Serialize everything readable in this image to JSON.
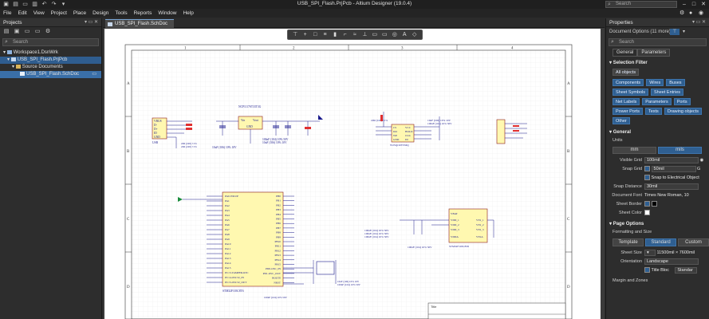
{
  "window": {
    "title": "USB_SPI_Flash.PrjPcb - Altium Designer (19.0.4)",
    "search_placeholder": "Search"
  },
  "menu": [
    "File",
    "Edit",
    "View",
    "Project",
    "Place",
    "Design",
    "Tools",
    "Reports",
    "Window",
    "Help"
  ],
  "projects_panel": {
    "title": "Projects",
    "search_placeholder": "Search",
    "tree": [
      {
        "label": "Workspace1.DsnWrk"
      },
      {
        "label": "USB_SPI_Flash.PrjPcb"
      },
      {
        "label": "Source Documents"
      },
      {
        "label": "USB_SPI_Flash.SchDoc"
      }
    ]
  },
  "document": {
    "tab": "USB_SPI_Flash.SchDoc",
    "col_labels": [
      "1",
      "2",
      "3",
      "4"
    ],
    "row_labels": [
      "A",
      "B",
      "C",
      "D"
    ],
    "title_block": "Title",
    "components": {
      "J1_labels": [
        "VBUS",
        "D-",
        "D+",
        "ID",
        "GND"
      ],
      "J1_name": "USB",
      "u_ldo": "NCP1117ST33T3G",
      "u_ldo_pins": [
        "Vin",
        "Vout",
        "GND"
      ],
      "flash_u": "W25Q16JVSSIQ",
      "flash_pins": [
        "CS",
        "DO",
        "WP",
        "GND",
        "VCC",
        "HOLD",
        "CLK",
        "DI"
      ],
      "mcu": "STM32F103C8T6",
      "mcu_left_pins": [
        "PA0-WKUP",
        "PA1",
        "PA2",
        "PA3",
        "PA4",
        "PA5",
        "PA6",
        "PA7",
        "PA8",
        "PA9",
        "PA10",
        "PA11",
        "PA12",
        "PA13",
        "PA14",
        "PA15",
        "PC13-TAMPER-RTC",
        "PC14-OSC32_IN",
        "PC15-OSC32_OUT"
      ],
      "mcu_right_pins": [
        "PB0",
        "PB1",
        "PB2",
        "PB3",
        "PB4",
        "PB5",
        "PB6",
        "PB7",
        "PB8",
        "PB9",
        "PB10",
        "PB11",
        "PB12",
        "PB13",
        "PB14",
        "PB15",
        "PD0-OSC_IN",
        "PD1-OSC_OUT",
        "BOOT0",
        "NRST"
      ],
      "pwr_u": "STM32F103C8T6",
      "pwr_pins": [
        "VBAT",
        "VDD_1",
        "VDD_2",
        "VDD_3",
        "VSS_1",
        "VSS_2",
        "VSS_3",
        "VDDA",
        "VSSA"
      ],
      "cap_note": "100nF (104) 10% 50V",
      "cap_note2": "10uF (106) 10% 10V",
      "res_note": "22R (220) ±1%"
    }
  },
  "properties_panel": {
    "title": "Properties",
    "subtitle": "Document Options (11 more)",
    "search_placeholder": "Search",
    "tabs": [
      "General",
      "Parameters"
    ],
    "selection_filter": {
      "heading": "Selection Filter",
      "all": "All objects",
      "items": [
        "Components",
        "Wires",
        "Buses",
        "Sheet Symbols",
        "Sheet Entries",
        "Net Labels",
        "Parameters",
        "Ports",
        "Power Ports",
        "Texts",
        "Drawing objects",
        "Other"
      ]
    },
    "general": {
      "heading": "General",
      "units_label": "Units",
      "units": [
        "mm",
        "mils"
      ],
      "visible_grid_label": "Visible Grid",
      "visible_grid": "100mil",
      "snap_grid_label": "Snap Grid",
      "snap_grid": "50mil",
      "snap_electrical": "Snap to Electrical Object",
      "snap_distance_label": "Snap Distance",
      "snap_distance": "30mil",
      "doc_font_label": "Document Font",
      "doc_font": "Times New Roman, 10",
      "sheet_border_label": "Sheet Border",
      "sheet_color_label": "Sheet Color"
    },
    "page_options": {
      "heading": "Page Options",
      "formatting_label": "Formatting and Size",
      "buttons": [
        "Template",
        "Standard",
        "Custom"
      ],
      "sheet_size_label": "Sheet Size",
      "sheet_size": "11500mil × 7600mil",
      "orientation_label": "Orientation",
      "orientation": "Landscape",
      "title_block_label": "Title Bloc",
      "title_block": "Standar",
      "margin_label": "Margin and Zones"
    }
  },
  "colors": {
    "accent": "#2f5f91",
    "schematic_line": "#1a1a8c",
    "component_fill": "#fff8b0",
    "sheet": "#ffffff"
  }
}
